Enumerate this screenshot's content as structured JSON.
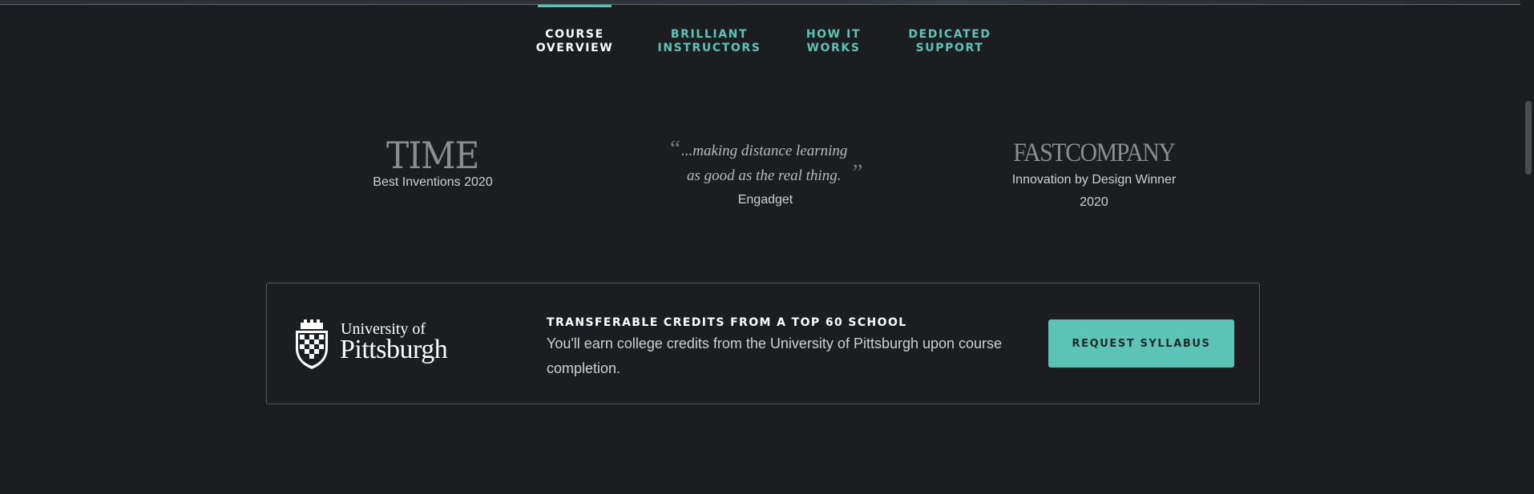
{
  "tabs": [
    {
      "label": "COURSE\nOVERVIEW",
      "active": true
    },
    {
      "label": "BRILLIANT\nINSTRUCTORS",
      "active": false
    },
    {
      "label": "HOW IT\nWORKS",
      "active": false
    },
    {
      "label": "DEDICATED\nSUPPORT",
      "active": false
    }
  ],
  "press": {
    "time": {
      "logo": "TIME",
      "caption": "Best Inventions 2020"
    },
    "quote": {
      "line1": "...making distance learning",
      "line2": "as good as the real thing.",
      "source": "Engadget"
    },
    "fastco": {
      "logo": "FASTCOMPANY",
      "caption_line1": "Innovation by Design Winner",
      "caption_line2": "2020"
    }
  },
  "credits": {
    "logo_line1": "University of",
    "logo_line2": "Pittsburgh",
    "heading": "TRANSFERABLE CREDITS FROM A TOP 60 SCHOOL",
    "body": "You'll earn college credits from the University of Pittsburgh upon course completion.",
    "button_label": "REQUEST SYLLABUS"
  },
  "colors": {
    "background": "#1c1d20",
    "accent": "#5cc4b6",
    "card_border": "#55585c"
  }
}
